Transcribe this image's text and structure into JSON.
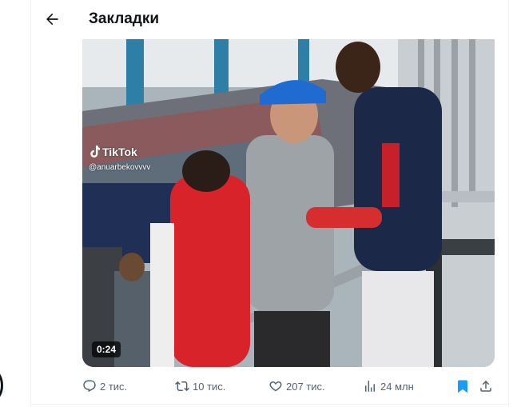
{
  "header": {
    "title": "Закладки"
  },
  "video": {
    "watermark_brand": "TikTok",
    "watermark_handle": "@anuarbekovvvv",
    "duration": "0:24"
  },
  "actions": {
    "replies": "2 тис.",
    "reposts": "10 тис.",
    "likes": "207 тис.",
    "views": "24 млн"
  },
  "colors": {
    "accent": "#1d9bf0",
    "muted_text": "#536471",
    "border": "#eff3f4"
  },
  "icons": [
    "back-arrow-icon",
    "reply-icon",
    "repost-icon",
    "like-icon",
    "views-icon",
    "bookmark-icon",
    "share-icon"
  ]
}
